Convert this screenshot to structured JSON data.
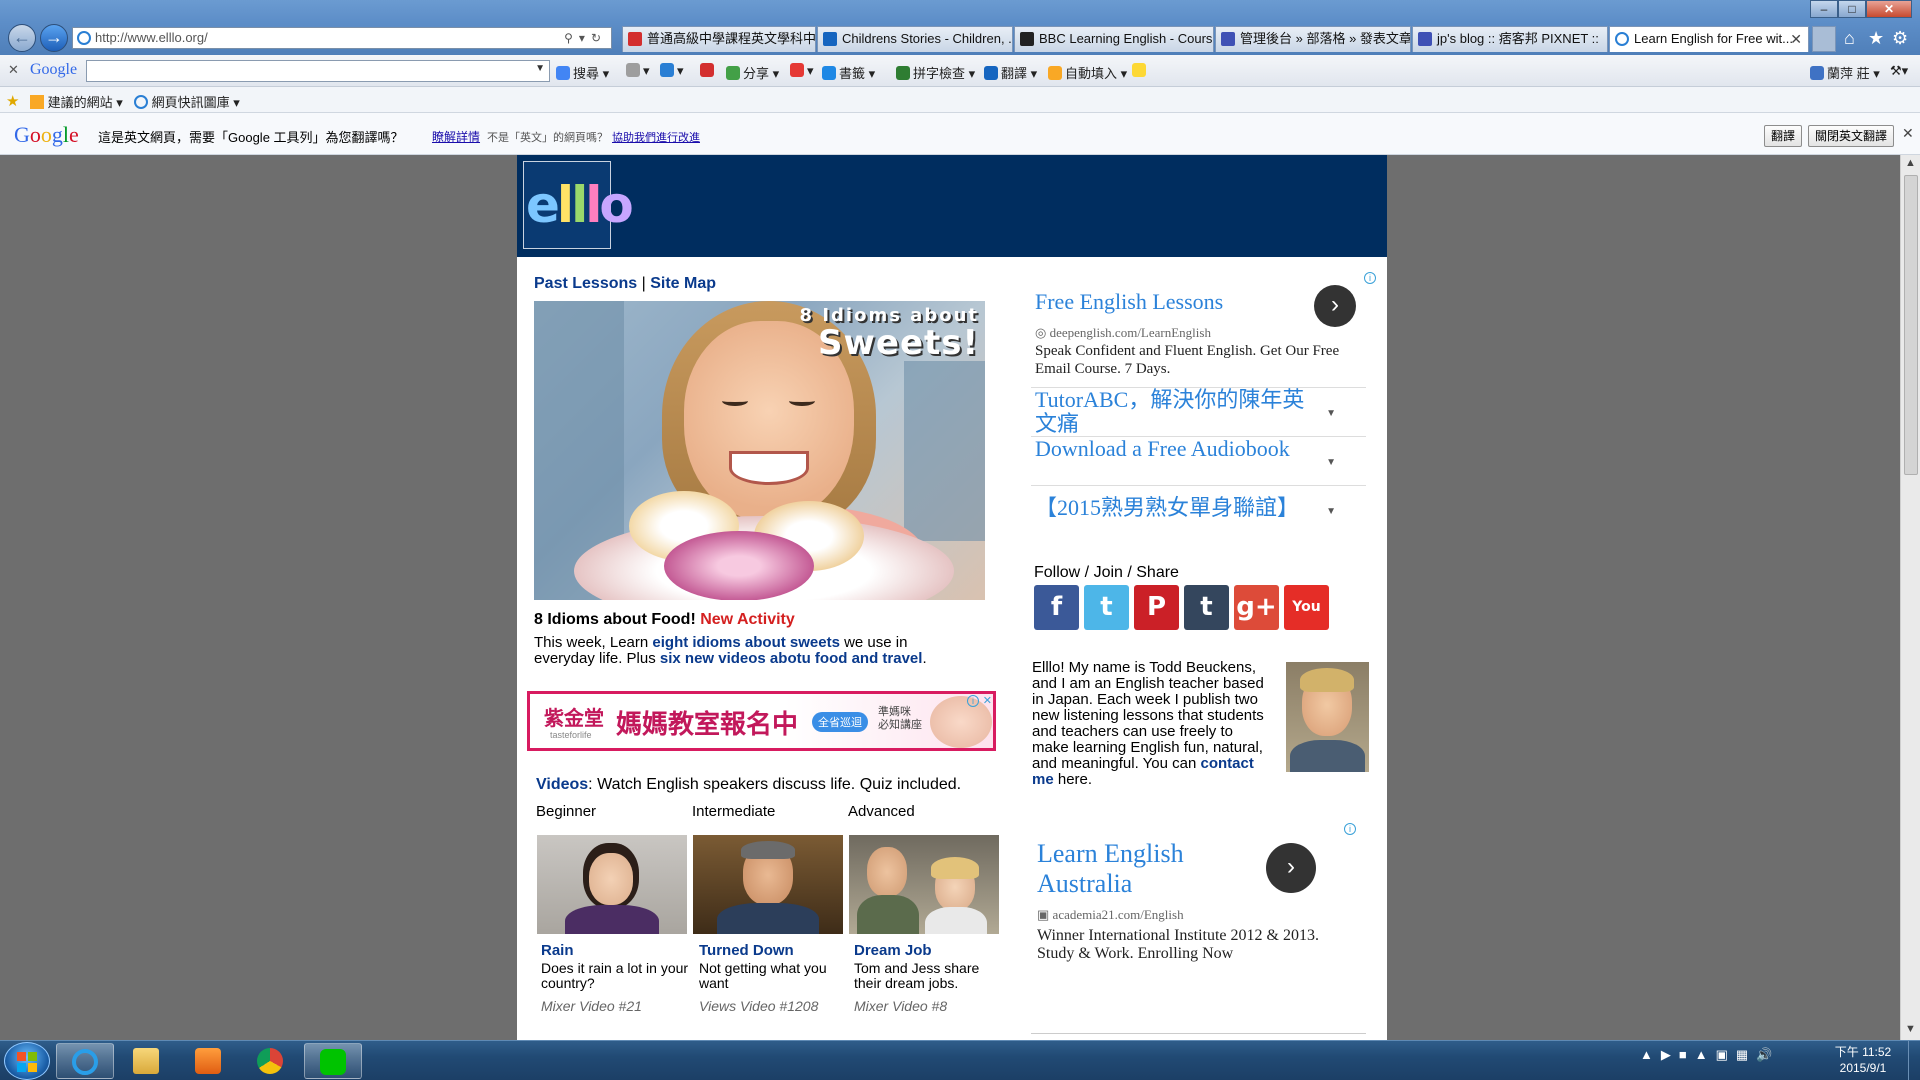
{
  "browser": {
    "url": "http://www.elllo.org/",
    "tabs": [
      {
        "label": "普通高級中學課程英文學科中...",
        "color": "#d32f2f"
      },
      {
        "label": "Childrens Stories - Children, ...",
        "color": "#1565c0"
      },
      {
        "label": "BBC Learning English - Cours...",
        "color": "#222222"
      },
      {
        "label": "管理後台 » 部落格 » 發表文章",
        "color": "#3f51b5"
      },
      {
        "label": "jp's blog :: 痞客邦 PIXNET ::",
        "color": "#3f51b5"
      },
      {
        "label": "Learn English for Free wit...",
        "color": "#2a7fd4"
      }
    ],
    "google_toolbar": {
      "logo": "Google",
      "items": [
        "搜尋",
        "分享",
        "書籤",
        "拼字檢查",
        "翻譯",
        "自動填入"
      ],
      "user": "蘭萍 莊"
    },
    "favorites": [
      "建議的網站",
      "網頁快訊圖庫"
    ],
    "translate_bar": {
      "logo": "Google",
      "message": "這是英文網頁，需要「Google 工具列」為您翻譯嗎？",
      "learn_more": "瞭解詳情",
      "not_english": "不是「英文」的網頁嗎？",
      "help": "協助我們進行改進",
      "translate_btn": "翻譯",
      "close_btn": "關閉英文翻譯"
    }
  },
  "site": {
    "logo_text": "elllo",
    "nav": {
      "past_lessons": "Past Lessons",
      "sep": "|",
      "site_map": "Site Map"
    },
    "feature": {
      "image_line1": "8 Idioms about",
      "image_line2": "Sweets!",
      "heading": "8 Idioms about Food!",
      "new_tag": "New Activity",
      "desc_pre": "This week, Learn ",
      "desc_link1": "eight idioms about sweets",
      "desc_mid": " we use in everyday life. Plus ",
      "desc_link2": "six new videos abotu food and travel",
      "desc_end": "."
    },
    "banner_ad": {
      "brand": "紫金堂",
      "brand_sub": "tasteforlife",
      "main": "媽媽教室報名中",
      "pill": "全省巡迴",
      "side_line1": "準媽咪",
      "side_line2": "必知講座"
    },
    "videos": {
      "label": "Videos",
      "text": ": Watch English speakers discuss life. Quiz included.",
      "levels": [
        "Beginner",
        "Intermediate",
        "Advanced"
      ],
      "items": [
        {
          "title": "Rain",
          "desc": "Does it rain a lot in your country?",
          "source": "Mixer Video #21"
        },
        {
          "title": "Turned Down",
          "desc": "Not getting what you want",
          "source": "Views Video #1208"
        },
        {
          "title": "Dream Job",
          "desc": "Tom and Jess share their dream jobs.",
          "source": "Mixer Video #8"
        }
      ]
    },
    "ad1": {
      "headline": "Free English Lessons",
      "url": "deepenglish.com/LearnEnglish",
      "body": "Speak Confident and Fluent English. Get Our Free Email Course. 7 Days.",
      "rows": [
        "TutorABC，解決你的陳年英文痛",
        "Download a Free Audiobook",
        "【2015熟男熟女單身聯誼】"
      ]
    },
    "follow": {
      "label": "Follow / Join / Share",
      "icons": [
        {
          "name": "facebook",
          "glyph": "f",
          "color": "#3b5998"
        },
        {
          "name": "twitter",
          "glyph": "t",
          "color": "#4db6e8"
        },
        {
          "name": "pinterest",
          "glyph": "P",
          "color": "#cb2027"
        },
        {
          "name": "tumblr",
          "glyph": "t",
          "color": "#34465d"
        },
        {
          "name": "google-plus",
          "glyph": "g+",
          "color": "#dd4b39"
        },
        {
          "name": "youtube",
          "glyph": "You",
          "color": "#e52d27"
        }
      ]
    },
    "about": {
      "text": "Elllo! My name is Todd Beuckens, and I am an English teacher based in Japan. Each week I publish two new listening lessons that students and teachers can use freely to make learning English fun, natural, and meaningful. You can ",
      "link": "contact me",
      "end": " here."
    },
    "ad2": {
      "headline": "Learn English Australia",
      "url": "academia21.com/English",
      "body": "Winner International Institute 2012 & 2013. Study & Work. Enrolling Now"
    }
  },
  "taskbar": {
    "clock_ampm": "下午 11:52",
    "date": "2015/9/1"
  }
}
